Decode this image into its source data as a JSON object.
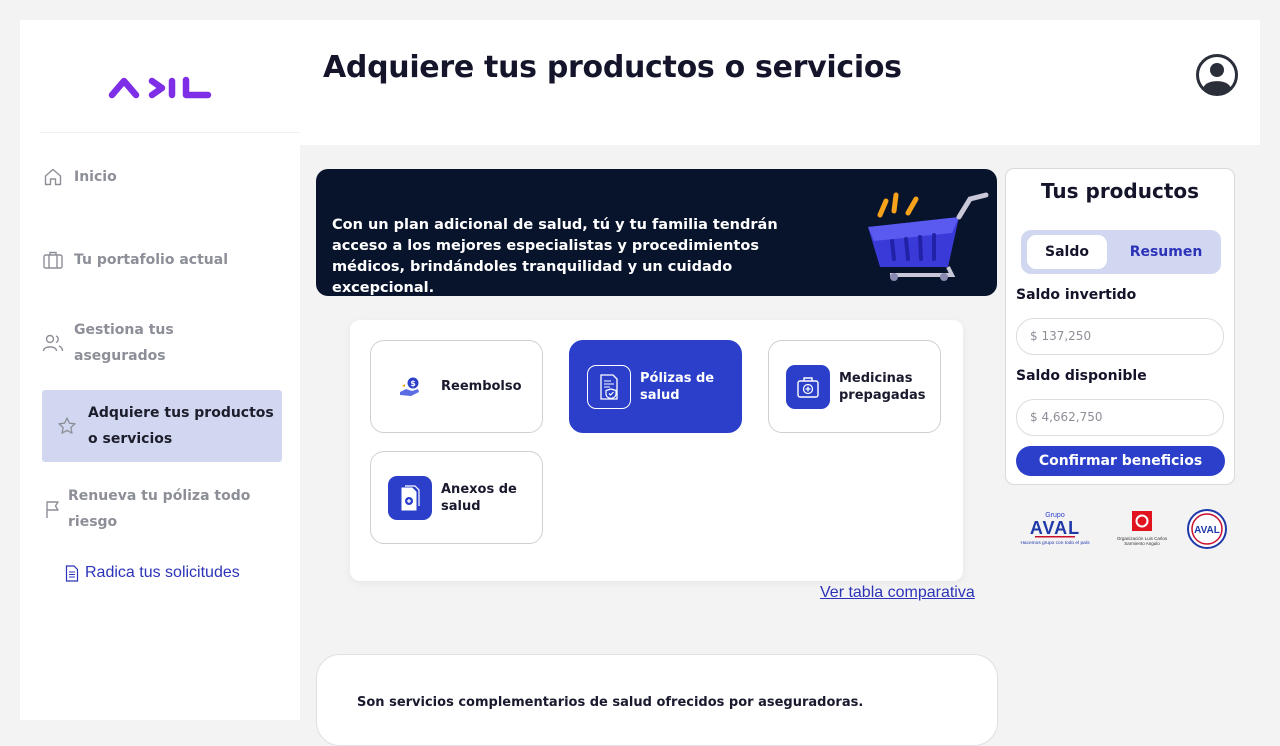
{
  "brand": {
    "logo_text": "ADL",
    "accent": "#2b3fcb",
    "logo_color": "#7d2ee6"
  },
  "header": {
    "title": "Adquiere tus productos o servicios",
    "avatar_icon": "user-circle-icon"
  },
  "sidebar": {
    "items": [
      {
        "label": "Inicio",
        "icon": "home-icon"
      },
      {
        "label": "Tu portafolio actual",
        "icon": "briefcase-icon"
      },
      {
        "label": "Gestiona tus asegurados",
        "icon": "users-icon"
      },
      {
        "label": "Adquiere tus productos o servicios",
        "icon": "star-icon",
        "active": true
      },
      {
        "label": "Renueva tu póliza todo riesgo",
        "icon": "flag-icon"
      }
    ],
    "link": {
      "label": "Radica tus solicitudes",
      "icon": "document-icon"
    }
  },
  "banner": {
    "text": "Con un plan adicional de salud, tú y tu familia tendrán acceso a los mejores especialistas y procedimientos médicos, brindándoles tranquilidad y un cuidado excepcional.",
    "image": "shopping-cart-icon"
  },
  "cards": [
    {
      "label": "Reembolso",
      "icon": "refund-hand-icon",
      "selected": false
    },
    {
      "label": "Pólizas de salud",
      "icon": "health-policy-icon",
      "selected": true
    },
    {
      "label": "Medicinas prepagadas",
      "icon": "medical-kit-icon",
      "selected": false
    },
    {
      "label": "Anexos de salud",
      "icon": "health-annex-icon",
      "selected": false
    }
  ],
  "compare_link": "Ver tabla comparativa",
  "info": {
    "text": "Son servicios complementarios de salud ofrecidos por aseguradoras."
  },
  "products": {
    "title": "Tus productos",
    "tabs": [
      "Saldo",
      "Resumen"
    ],
    "active_tab": "Saldo",
    "invested_label": "Saldo invertido",
    "invested_value": "$ 137,250",
    "available_label": "Saldo disponible",
    "available_value": "$ 4,662,750",
    "confirm_label": "Confirmar beneficios"
  },
  "partners": {
    "aval_top": "Grupo",
    "aval_name": "AVAL",
    "aval_tagline": "Hacemos grupo con todo el país",
    "olc_caption_1": "Organización Luis Carlos",
    "olc_caption_2": "Sarmiento Angulo",
    "seal_text": "AVAL"
  }
}
